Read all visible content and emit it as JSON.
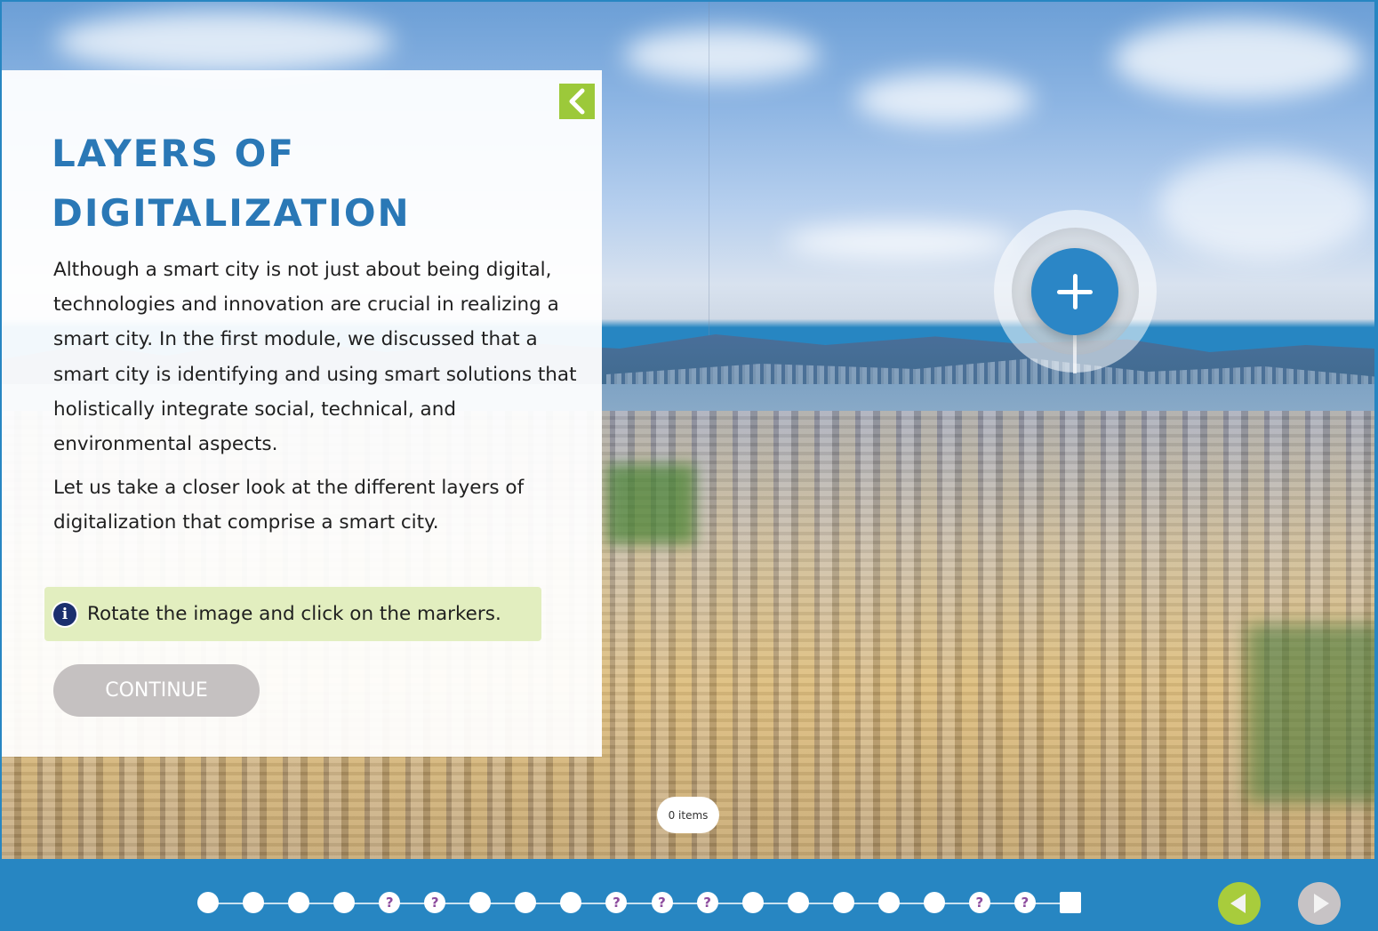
{
  "panel": {
    "title_line1": "LAYERS OF",
    "title_line2": "DIGITALIZATION",
    "paragraphs": [
      "Although a smart city is not just about being digital, technologies and innovation are crucial in realizing a smart city. In the first module, we discussed that a smart city is identifying and using smart solutions that holistically integrate social, technical, and environmental aspects.",
      "Let us take a closer look at the different layers of digitalization that comprise a smart city."
    ],
    "hint": "Rotate the image and click on the markers.",
    "hint_icon": "info-icon",
    "continue_label": "CONTINUE",
    "back_icon": "chevron-left-icon"
  },
  "scene": {
    "marker_icon": "plus-icon",
    "items_badge": "0 items"
  },
  "navigation": {
    "steps": [
      {
        "type": "page",
        "label": ""
      },
      {
        "type": "page",
        "label": ""
      },
      {
        "type": "page",
        "label": ""
      },
      {
        "type": "page",
        "label": ""
      },
      {
        "type": "quiz",
        "label": "?"
      },
      {
        "type": "quiz",
        "label": "?"
      },
      {
        "type": "page",
        "label": ""
      },
      {
        "type": "page",
        "label": ""
      },
      {
        "type": "page",
        "label": ""
      },
      {
        "type": "quiz",
        "label": "?"
      },
      {
        "type": "quiz",
        "label": "?"
      },
      {
        "type": "quiz",
        "label": "?"
      },
      {
        "type": "page",
        "label": ""
      },
      {
        "type": "page",
        "label": ""
      },
      {
        "type": "page",
        "label": ""
      },
      {
        "type": "page",
        "label": ""
      },
      {
        "type": "page",
        "label": ""
      },
      {
        "type": "quiz",
        "label": "?"
      },
      {
        "type": "quiz",
        "label": "?"
      },
      {
        "type": "end",
        "label": ""
      }
    ],
    "prev_icon": "triangle-left-icon",
    "next_icon": "triangle-right-icon",
    "colors": {
      "bar": "#2786c2",
      "prev_button": "#a8cc3c",
      "next_button_disabled": "#c7c3c5",
      "quiz_mark": "#8d4c9e"
    }
  },
  "colors": {
    "title": "#2a78b6",
    "hint_bg": "#e2eebf",
    "back_button": "#9cc93a",
    "continue_disabled": "#c5c1c1",
    "marker": "#2b86c6"
  }
}
